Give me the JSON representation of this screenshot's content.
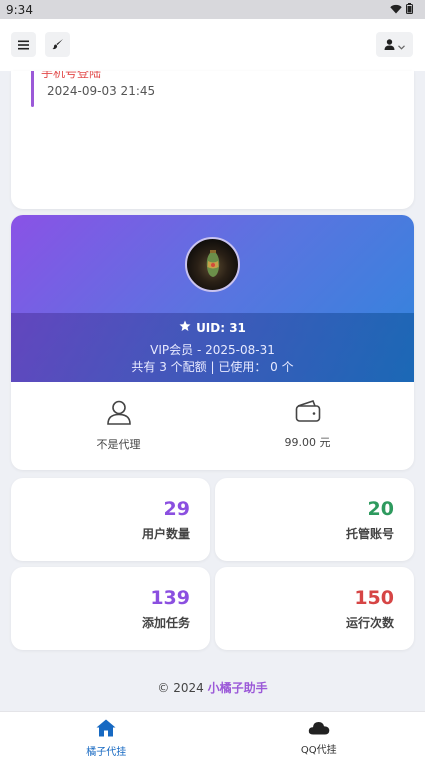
{
  "status_bar": {
    "time": "9:34",
    "icons": [
      "wifi-icon",
      "battery-icon"
    ]
  },
  "topbar": {
    "icons": [
      "menu-icon",
      "brush-icon",
      "user-icon",
      "chevron-down-icon"
    ]
  },
  "login_log": {
    "title": "手机号登陆",
    "time": "2024-09-03 21:45"
  },
  "profile": {
    "uid_label": "UID: 31",
    "vip_line": "VIP会员 - 2025-08-31",
    "quota_line": "共有 3 个配额 | 已使用： 0 个",
    "agent_label": "不是代理",
    "balance_label": "99.00 元"
  },
  "stats": [
    {
      "value": "29",
      "label": "用户数量",
      "color": "#8b4fe0"
    },
    {
      "value": "20",
      "label": "托管账号",
      "color": "#2e9a5e"
    },
    {
      "value": "139",
      "label": "添加任务",
      "color": "#8b4fe0"
    },
    {
      "value": "150",
      "label": "运行次数",
      "color": "#d64545"
    }
  ],
  "footer": {
    "copyright": "© 2024",
    "brand": "小橘子助手"
  },
  "bottom_nav": [
    {
      "label": "橘子代挂",
      "icon": "home-icon",
      "active": true
    },
    {
      "label": "QQ代挂",
      "icon": "cloud-icon",
      "active": false
    }
  ],
  "colors": {
    "accent_purple": "#9b59d8",
    "active_blue": "#1769c2"
  }
}
